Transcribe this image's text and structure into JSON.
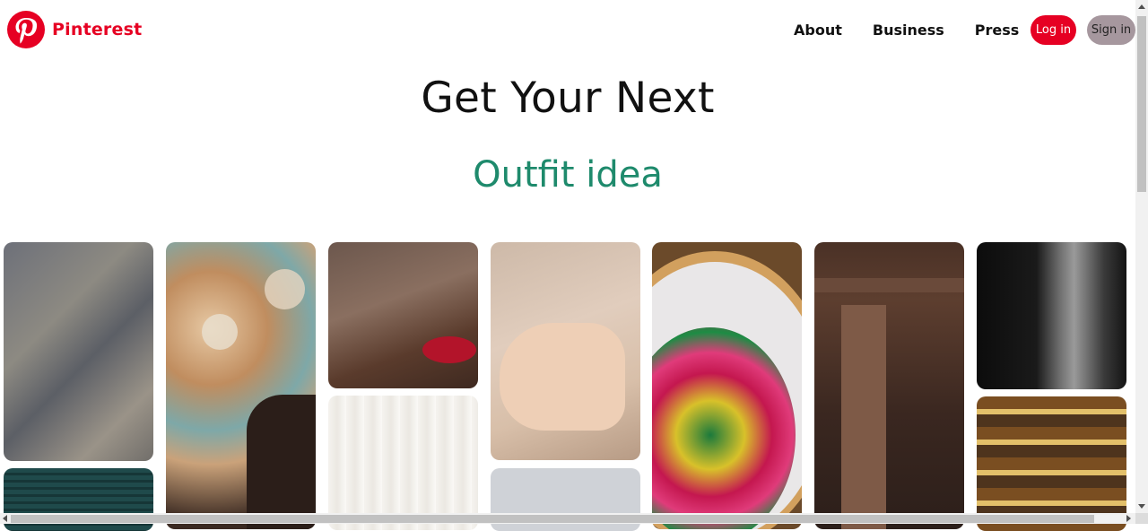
{
  "header": {
    "logo_name": "Pinterest",
    "logo_icon": "pinterest-logo-icon",
    "nav": [
      "About",
      "Business",
      "Press"
    ],
    "login_label": "Log in",
    "signin_label": "Sign in"
  },
  "hero": {
    "headline": "Get Your Next",
    "subline": "Outfit idea"
  },
  "colors": {
    "brand": "#e60023",
    "accent": "#1e8a6c",
    "signin_bg": "#a6979e"
  },
  "pins": [
    {
      "name": "pin-weathered-wood"
    },
    {
      "name": "pin-teal-shutters"
    },
    {
      "name": "pin-lanterns-woman"
    },
    {
      "name": "pin-spice-bowl"
    },
    {
      "name": "pin-white-curtain"
    },
    {
      "name": "pin-hand-brush"
    },
    {
      "name": "pin-grey-wall"
    },
    {
      "name": "pin-embroidery-hoop"
    },
    {
      "name": "pin-wooden-doorway"
    },
    {
      "name": "pin-dark-stone"
    },
    {
      "name": "pin-wooden-beams"
    }
  ]
}
